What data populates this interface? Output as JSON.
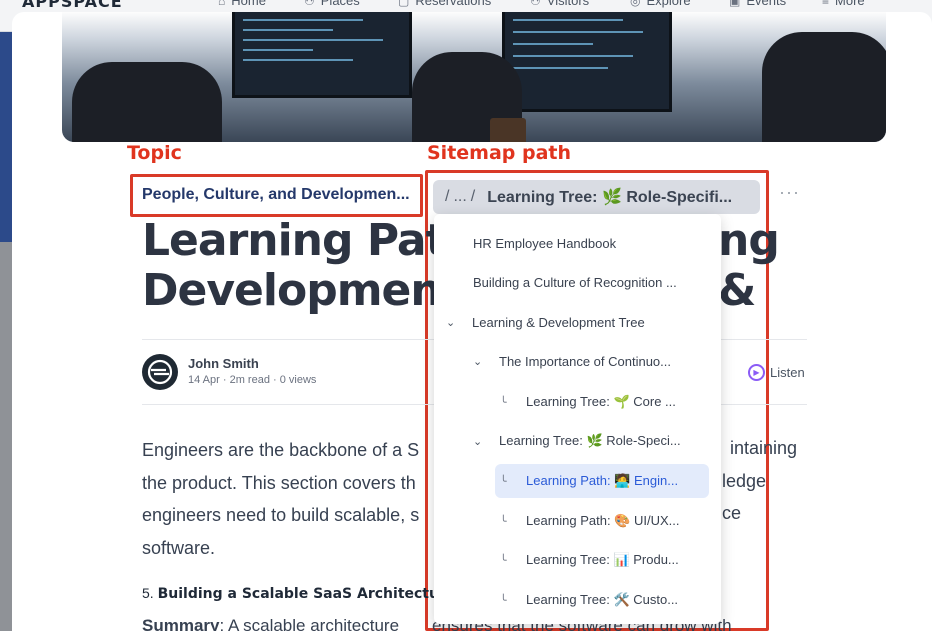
{
  "nav": {
    "logo": "APPSPACE",
    "items": [
      {
        "label": "Home",
        "icon": "home-icon",
        "glyph": "⌂"
      },
      {
        "label": "Places",
        "icon": "people-icon",
        "glyph": "⚇"
      },
      {
        "label": "Reservations",
        "icon": "calendar-icon",
        "glyph": "▢"
      },
      {
        "label": "Visitors",
        "icon": "visitors-icon",
        "glyph": "⚇"
      },
      {
        "label": "Explore",
        "icon": "compass-icon",
        "glyph": "◎"
      },
      {
        "label": "Events",
        "icon": "calendar-icon",
        "glyph": "▣"
      },
      {
        "label": "More",
        "icon": "menu-icon",
        "glyph": "≡"
      }
    ]
  },
  "annotations": {
    "topic_label": "Topic",
    "sitemap_label": "Sitemap path"
  },
  "article": {
    "topic": "People, Culture, and Developmen...",
    "breadcrumb": {
      "slash": "/",
      "ellipsis": "...",
      "current": "Learning Tree: 🌿 Role-Specifi..."
    },
    "more_dots": "···",
    "title_line1": "Learning Path",
    "title_line1_tail": "ng &",
    "title_line2": "Development",
    "author": {
      "name": "John Smith",
      "meta": "14 Apr · 2m read · 0 views"
    },
    "listen_fragment": "n",
    "listen_label": "Listen",
    "body_lines": [
      "Engineers are the backbone of a S",
      "the product. This section covers th",
      "engineers need to build scalable, s",
      "software."
    ],
    "body_tails": [
      "intaining",
      "ledge",
      "ce"
    ],
    "section_number": "5.",
    "section_title": "Building a Scalable SaaS Architecture",
    "summary_label": "Summary",
    "summary_text": ": A scalable architecture",
    "summary_tail": "ensures that the software can grow with"
  },
  "sitemap": {
    "items": [
      {
        "label": "HR Employee Handbook",
        "level": 0,
        "kind": "page"
      },
      {
        "label": "Building a Culture of Recognition ...",
        "level": 0,
        "kind": "page"
      },
      {
        "label": "Learning & Development Tree",
        "level": 0,
        "kind": "expanded"
      },
      {
        "label": "The Importance of Continuo...",
        "level": 1,
        "kind": "expanded"
      },
      {
        "label": "Learning Tree: 🌱 Core ...",
        "level": 2,
        "kind": "leaf"
      },
      {
        "label": "Learning Tree: 🌿 Role-Speci...",
        "level": 1,
        "kind": "expanded"
      },
      {
        "label": "Learning Path: 🧑‍💻 Engin...",
        "level": 2,
        "kind": "leaf",
        "selected": true
      },
      {
        "label": "Learning Path: 🎨 UI/UX...",
        "level": 2,
        "kind": "leaf"
      },
      {
        "label": "Learning Tree: 📊 Produ...",
        "level": 2,
        "kind": "leaf"
      },
      {
        "label": "Learning Tree: 🛠️ Custo...",
        "level": 2,
        "kind": "leaf"
      }
    ]
  },
  "colors": {
    "annotation": "#e0341e",
    "topic": "#24386a",
    "selected_bg": "#e3ebfb",
    "selected_text": "#2b5bd7",
    "listen_accent": "#8b5cf6"
  }
}
